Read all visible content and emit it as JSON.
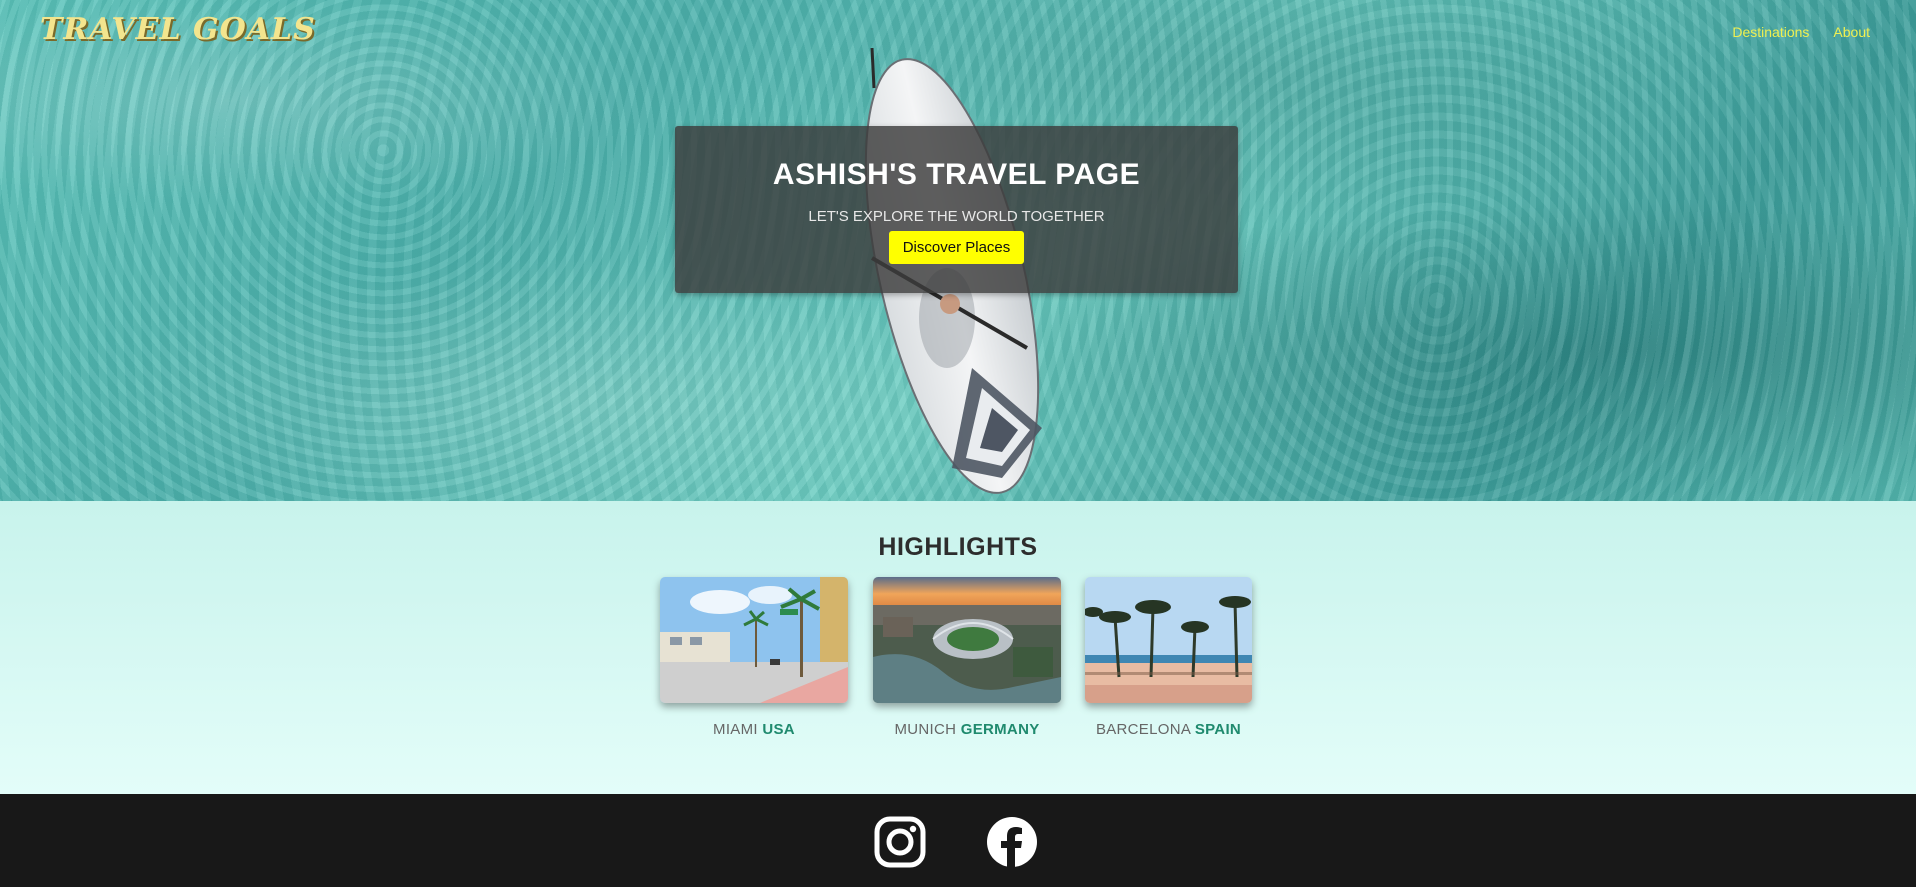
{
  "brand": {
    "name": "TRAVEL GOALS"
  },
  "nav": {
    "items": [
      {
        "label": "Destinations"
      },
      {
        "label": "About"
      }
    ]
  },
  "hero": {
    "title": "ASHISH'S TRAVEL PAGE",
    "subtitle": "LET'S EXPLORE THE WORLD TOGETHER",
    "button_label": "Discover Places"
  },
  "highlights": {
    "title": "HIGHLIGHTS",
    "cards": [
      {
        "city": "MIAMI",
        "country": "USA"
      },
      {
        "city": "MUNICH",
        "country": "GERMANY"
      },
      {
        "city": "BARCELONA",
        "country": "SPAIN"
      }
    ]
  },
  "footer": {
    "icons": [
      "instagram-icon",
      "facebook-icon"
    ]
  },
  "colors": {
    "accent": "#ffff00",
    "nav_link": "#f0f050",
    "country": "#1f8a6e",
    "footer_bg": "#181818"
  }
}
